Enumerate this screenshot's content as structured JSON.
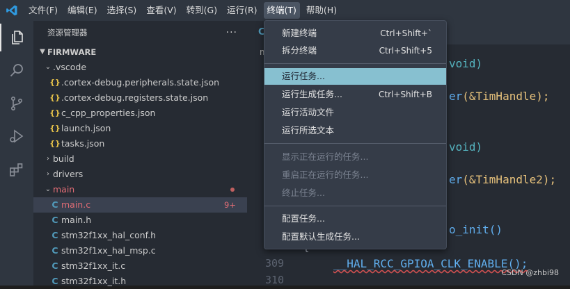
{
  "menubar": {
    "items": [
      {
        "label": "文件(F)"
      },
      {
        "label": "编辑(E)"
      },
      {
        "label": "选择(S)"
      },
      {
        "label": "查看(V)"
      },
      {
        "label": "转到(G)"
      },
      {
        "label": "运行(R)"
      },
      {
        "label": "终端(T)",
        "active": true
      },
      {
        "label": "帮助(H)"
      }
    ]
  },
  "activity_bar": {
    "icons": [
      "explorer-icon",
      "search-icon",
      "source-control-icon",
      "run-debug-icon",
      "extensions-icon"
    ]
  },
  "sidebar": {
    "title": "资源管理器",
    "more": "···",
    "root": "FIRMWARE",
    "tree": [
      {
        "label": ".vscode",
        "type": "folder",
        "open": true
      },
      {
        "label": ".cortex-debug.peripherals.state.json",
        "type": "json",
        "icon": "{}"
      },
      {
        "label": ".cortex-debug.registers.state.json",
        "type": "json",
        "icon": "{}"
      },
      {
        "label": "c_cpp_properties.json",
        "type": "json",
        "icon": "{}"
      },
      {
        "label": "launch.json",
        "type": "json",
        "icon": "{}"
      },
      {
        "label": "tasks.json",
        "type": "json",
        "icon": "{}"
      },
      {
        "label": "build",
        "type": "folder",
        "open": false
      },
      {
        "label": "drivers",
        "type": "folder",
        "open": false
      },
      {
        "label": "main",
        "type": "folder",
        "open": true,
        "modified": true
      },
      {
        "label": "main.c",
        "type": "c",
        "icon": "C",
        "selected": true,
        "badge": "9+"
      },
      {
        "label": "main.h",
        "type": "c",
        "icon": "C"
      },
      {
        "label": "stm32f1xx_hal_conf.h",
        "type": "c",
        "icon": "C"
      },
      {
        "label": "stm32f1xx_hal_msp.c",
        "type": "c",
        "icon": "C"
      },
      {
        "label": "stm32f1xx_it.c",
        "type": "c",
        "icon": "C"
      },
      {
        "label": "stm32f1xx_it.h",
        "type": "c",
        "icon": "C"
      }
    ]
  },
  "editor": {
    "tab_label": "C",
    "breadcrumb": "m",
    "code": {
      "line1": "void)",
      "line2_fn": "er",
      "line2_arg": "(&TimHandle);",
      "line3": "void)",
      "line4_fn": "er",
      "line4_arg": "(&TimHandle2);",
      "line5": "o_init()",
      "brace": "{",
      "macro": "__HAL_RCC_GPIOA_CLK_ENABLE();"
    },
    "line_numbers": [
      "309",
      "310"
    ],
    "watermark": "CSDN @zhbi98"
  },
  "terminal_menu": {
    "groups": [
      [
        {
          "label": "新建终端",
          "shortcut": "Ctrl+Shift+`"
        },
        {
          "label": "拆分终端",
          "shortcut": "Ctrl+Shift+5"
        }
      ],
      [
        {
          "label": "运行任务...",
          "shortcut": "",
          "highlight": true
        },
        {
          "label": "运行生成任务...",
          "shortcut": "Ctrl+Shift+B"
        },
        {
          "label": "运行活动文件",
          "shortcut": ""
        },
        {
          "label": "运行所选文本",
          "shortcut": ""
        }
      ],
      [
        {
          "label": "显示正在运行的任务...",
          "shortcut": "",
          "disabled": true
        },
        {
          "label": "重启正在运行的任务...",
          "shortcut": "",
          "disabled": true
        },
        {
          "label": "终止任务...",
          "shortcut": "",
          "disabled": true
        }
      ],
      [
        {
          "label": "配置任务...",
          "shortcut": ""
        },
        {
          "label": "配置默认生成任务...",
          "shortcut": ""
        }
      ]
    ]
  },
  "colors": {
    "menu_highlight": "#87c0d0",
    "c_file": "#519aba",
    "json_file": "#e8c44a",
    "modified": "#e06c75"
  }
}
